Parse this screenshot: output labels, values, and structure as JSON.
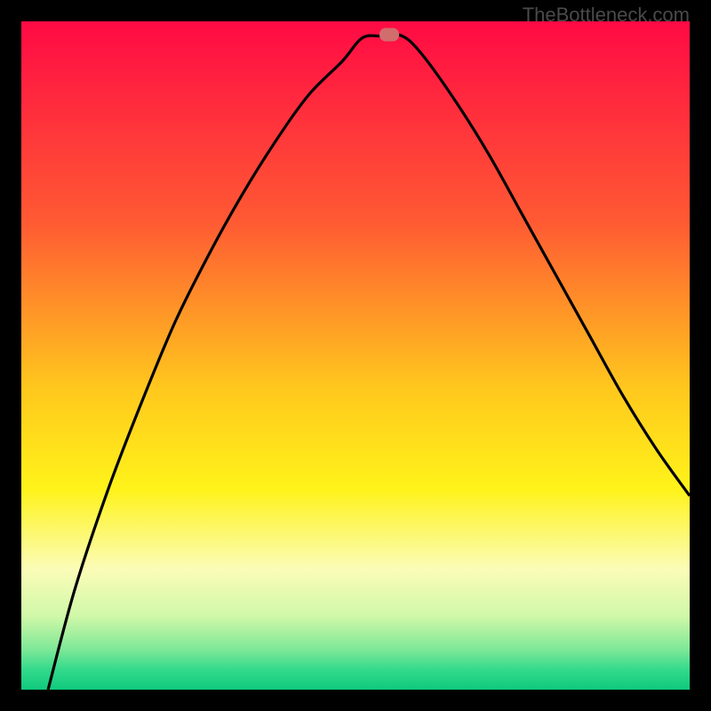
{
  "watermark": "TheBottleneck.com",
  "chart_data": {
    "type": "line",
    "title": "",
    "xlabel": "",
    "ylabel": "",
    "xlim": [
      0,
      100
    ],
    "ylim": [
      0,
      100
    ],
    "gradient_stops": [
      {
        "offset": 0,
        "color": "#ff0a44"
      },
      {
        "offset": 30,
        "color": "#ff5a33"
      },
      {
        "offset": 55,
        "color": "#ffc81d"
      },
      {
        "offset": 70,
        "color": "#fff31a"
      },
      {
        "offset": 82,
        "color": "#fbfcb8"
      },
      {
        "offset": 89,
        "color": "#d0f8a8"
      },
      {
        "offset": 94,
        "color": "#7de897"
      },
      {
        "offset": 97,
        "color": "#33da8c"
      },
      {
        "offset": 100,
        "color": "#0fc97c"
      }
    ],
    "marker": {
      "x": 55,
      "y": 98
    },
    "series": [
      {
        "name": "bottleneck-curve",
        "points": [
          {
            "x": 4,
            "y": 0
          },
          {
            "x": 8,
            "y": 15
          },
          {
            "x": 13,
            "y": 30
          },
          {
            "x": 18,
            "y": 43
          },
          {
            "x": 23,
            "y": 55
          },
          {
            "x": 28,
            "y": 65
          },
          {
            "x": 33,
            "y": 74
          },
          {
            "x": 38,
            "y": 82
          },
          {
            "x": 43,
            "y": 89
          },
          {
            "x": 48,
            "y": 94
          },
          {
            "x": 51,
            "y": 97.5
          },
          {
            "x": 54,
            "y": 97.8
          },
          {
            "x": 57,
            "y": 97.8
          },
          {
            "x": 60,
            "y": 95
          },
          {
            "x": 65,
            "y": 88
          },
          {
            "x": 70,
            "y": 80
          },
          {
            "x": 75,
            "y": 71
          },
          {
            "x": 80,
            "y": 62
          },
          {
            "x": 85,
            "y": 53
          },
          {
            "x": 90,
            "y": 44
          },
          {
            "x": 95,
            "y": 36
          },
          {
            "x": 100,
            "y": 29
          }
        ]
      }
    ]
  }
}
